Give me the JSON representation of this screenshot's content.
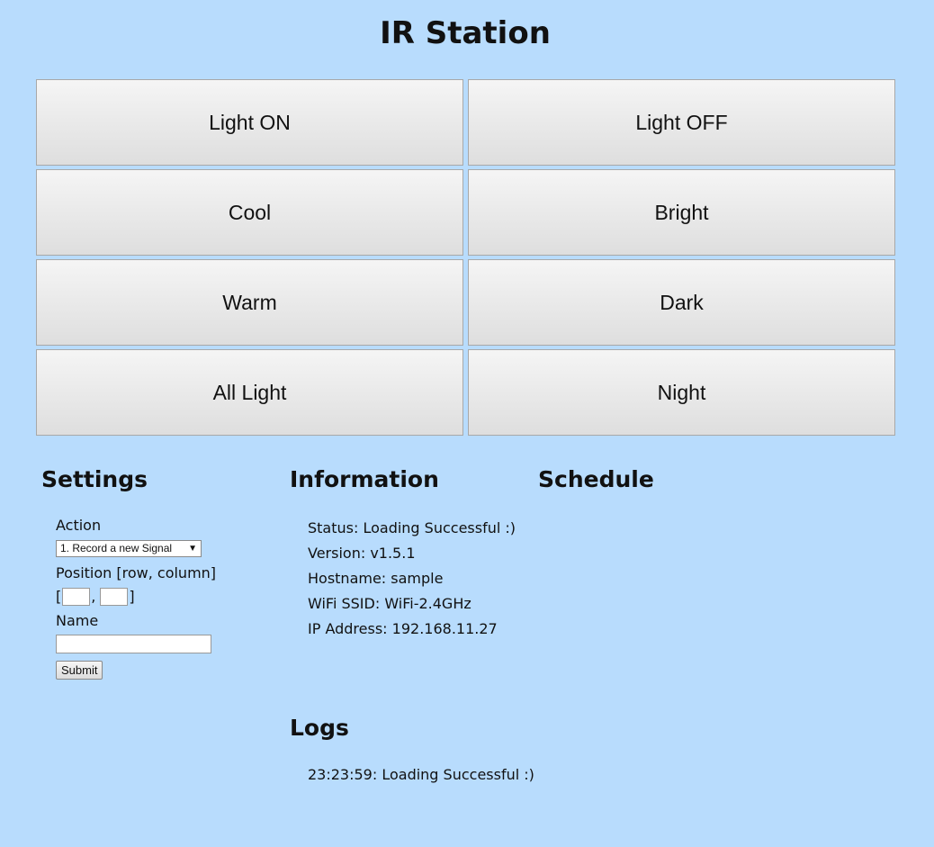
{
  "title": "IR Station",
  "signals": [
    {
      "label": "Light ON"
    },
    {
      "label": "Light OFF"
    },
    {
      "label": "Cool"
    },
    {
      "label": "Bright"
    },
    {
      "label": "Warm"
    },
    {
      "label": "Dark"
    },
    {
      "label": "All Light"
    },
    {
      "label": "Night"
    }
  ],
  "settings": {
    "heading": "Settings",
    "action_label": "Action",
    "action_selected": "1. Record a new Signal",
    "position_label": "Position [row, column]",
    "position_row_value": "",
    "position_column_value": "",
    "name_label": "Name",
    "name_value": "",
    "submit_label": "Submit"
  },
  "information": {
    "heading": "Information",
    "lines": [
      "Status: Loading Successful :)",
      "Version: v1.5.1",
      "Hostname: sample",
      "WiFi SSID: WiFi-2.4GHz",
      "IP Address: 192.168.11.27"
    ]
  },
  "schedule": {
    "heading": "Schedule"
  },
  "logs": {
    "heading": "Logs",
    "entries": [
      "23:23:59: Loading Successful :)"
    ]
  },
  "colors": {
    "background": "#b8dcfd"
  }
}
